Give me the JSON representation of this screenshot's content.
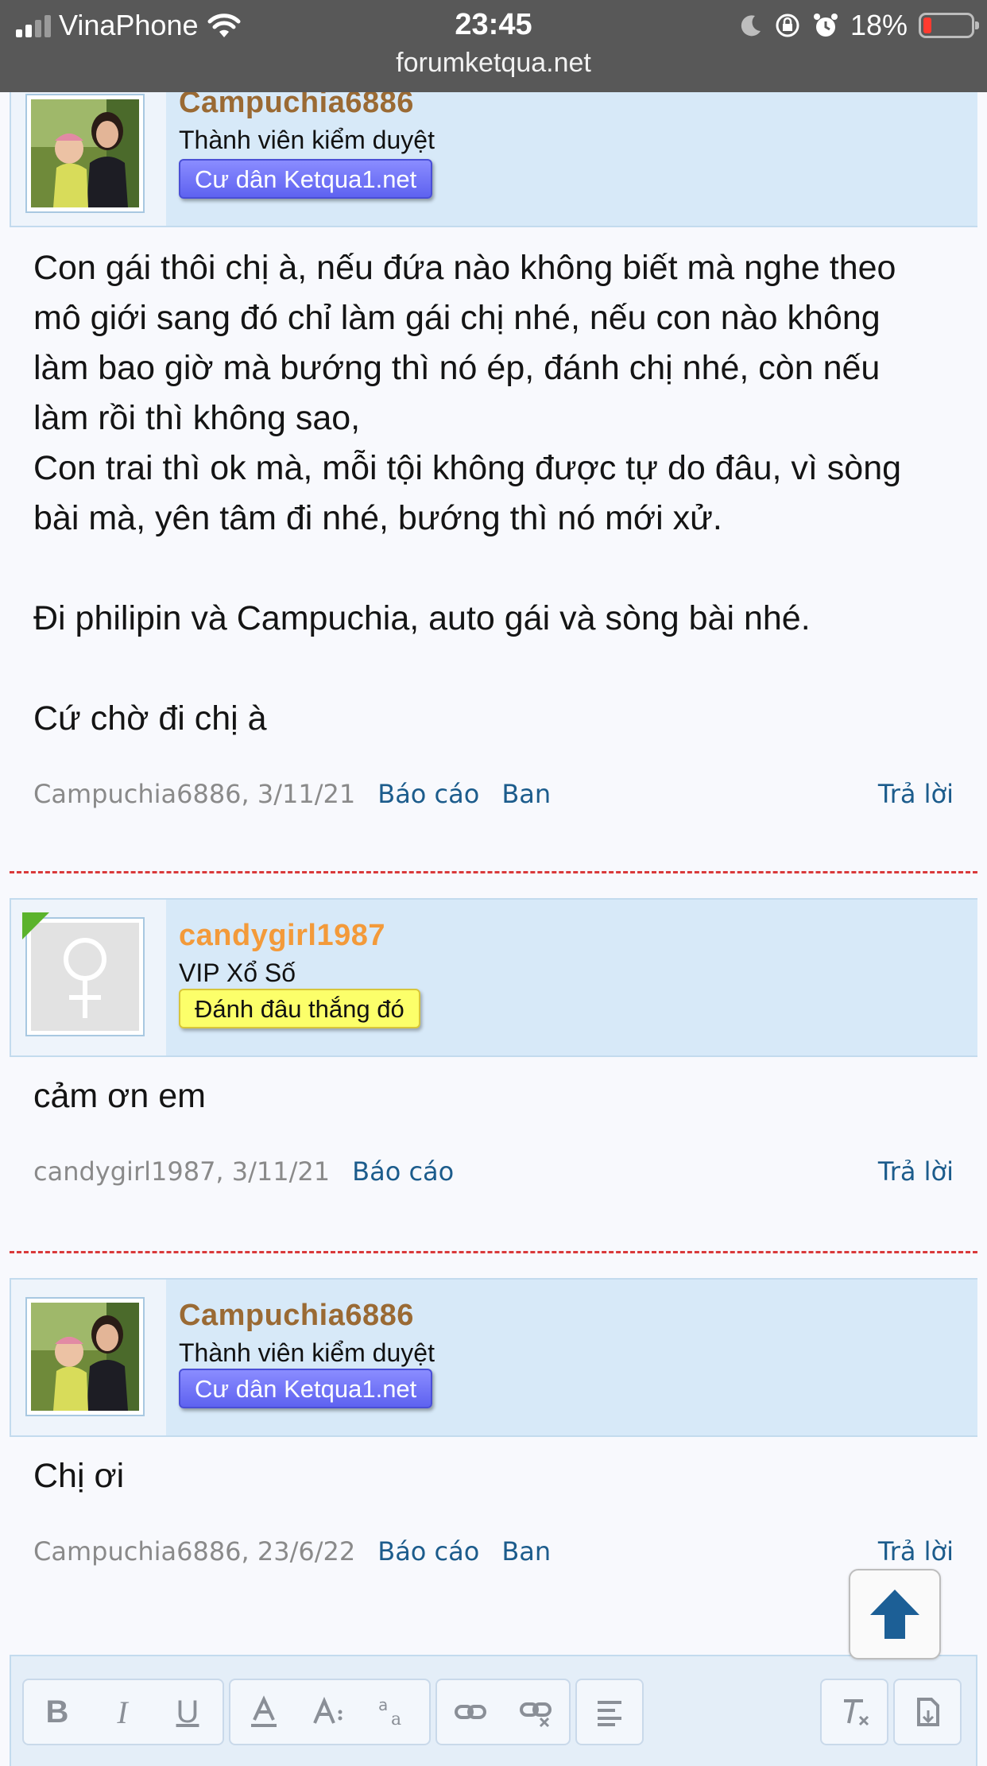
{
  "status_bar": {
    "carrier": "VinaPhone",
    "time": "23:45",
    "battery": "18%",
    "battery_level": 0.18,
    "url": "forumketqua.net"
  },
  "posts": [
    {
      "username": "Campuchia6886",
      "username_color": "#9a6a34",
      "user_title": "Thành viên kiểm duyệt",
      "badge": "Cư dân Ketqua1.net",
      "badge_style": "blue",
      "avatar_icon": "user-photo",
      "body": [
        "Con gái thôi chị à, nếu đứa nào không biết mà nghe theo",
        "mô giới sang đó chỉ làm gái chị nhé, nếu con nào không",
        "làm bao giờ mà bướng thì nó ép, đánh chị nhé, còn nếu",
        "làm rồi thì không sao,",
        "Con trai thì ok mà, mỗi tội không được tự do đâu, vì sòng",
        "bài mà, yên tâm đi nhé, bướng thì nó mới xử.",
        "",
        "Đi philipin và Campuchia, auto gái và sòng bài nhé.",
        "",
        "Cứ chờ đi chị à"
      ],
      "meta": "Campuchia6886, 3/11/21",
      "report": "Báo cáo",
      "ban": "Ban",
      "reply": "Trả lời"
    },
    {
      "username": "candygirl1987",
      "username_color": "#f39a3a",
      "user_title": "VIP Xổ Số",
      "badge": "Đánh đâu thắng đó",
      "badge_style": "yellow",
      "avatar_icon": "female-symbol",
      "online": true,
      "body": [
        "cảm ơn em"
      ],
      "meta": "candygirl1987, 3/11/21",
      "report": "Báo cáo",
      "reply": "Trả lời"
    },
    {
      "username": "Campuchia6886",
      "username_color": "#9a6a34",
      "user_title": "Thành viên kiểm duyệt",
      "badge": "Cư dân Ketqua1.net",
      "badge_style": "blue",
      "avatar_icon": "user-photo",
      "body": [
        "Chị ơi"
      ],
      "meta": "Campuchia6886, 23/6/22",
      "report": "Báo cáo",
      "ban": "Ban",
      "reply": "Trả lời"
    }
  ],
  "toolbar": {
    "bold": "B",
    "italic": "I",
    "underline": "U",
    "icons": [
      "bold-icon",
      "italic-icon",
      "underline-icon",
      "text-color-icon",
      "font-size-icon",
      "font-family-icon",
      "link-icon",
      "unlink-icon",
      "align-icon",
      "remove-format-icon",
      "insert-icon"
    ]
  },
  "colors": {
    "accent": "#1c5c8c",
    "separator": "#d9393a",
    "header_bg": "#d7e9f8"
  }
}
